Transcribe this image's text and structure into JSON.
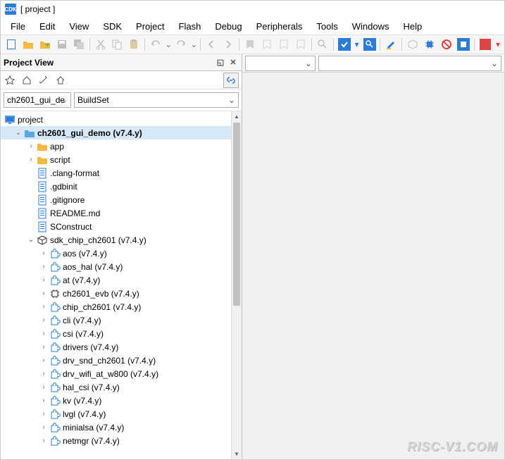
{
  "titlebar": {
    "app": "CDK",
    "title": "[ project ]"
  },
  "menu": [
    "File",
    "Edit",
    "View",
    "SDK",
    "Project",
    "Flash",
    "Debug",
    "Peripherals",
    "Tools",
    "Windows",
    "Help"
  ],
  "panel": {
    "title": "Project View",
    "projectCombo": "ch2601_gui_de",
    "buildsetCombo": "BuildSet"
  },
  "tree": {
    "root": "project",
    "projectNode": "ch2601_gui_demo (v7.4.y)",
    "folders": [
      "app",
      "script"
    ],
    "files": [
      ".clang-format",
      ".gdbinit",
      ".gitignore",
      "README.md",
      "SConstruct"
    ],
    "sdkNode": "sdk_chip_ch2601 (v7.4.y)",
    "components": [
      "aos (v7.4.y)",
      "aos_hal (v7.4.y)",
      "at (v7.4.y)",
      "ch2601_evb (v7.4.y)",
      "chip_ch2601 (v7.4.y)",
      "cli (v7.4.y)",
      "csi (v7.4.y)",
      "drivers (v7.4.y)",
      "drv_snd_ch2601 (v7.4.y)",
      "drv_wifi_at_w800 (v7.4.y)",
      "hal_csi (v7.4.y)",
      "kv (v7.4.y)",
      "lvgl (v7.4.y)",
      "minialsa (v7.4.y)",
      "netmgr (v7.4.y)"
    ]
  },
  "watermark": "RISC-V1.COM"
}
